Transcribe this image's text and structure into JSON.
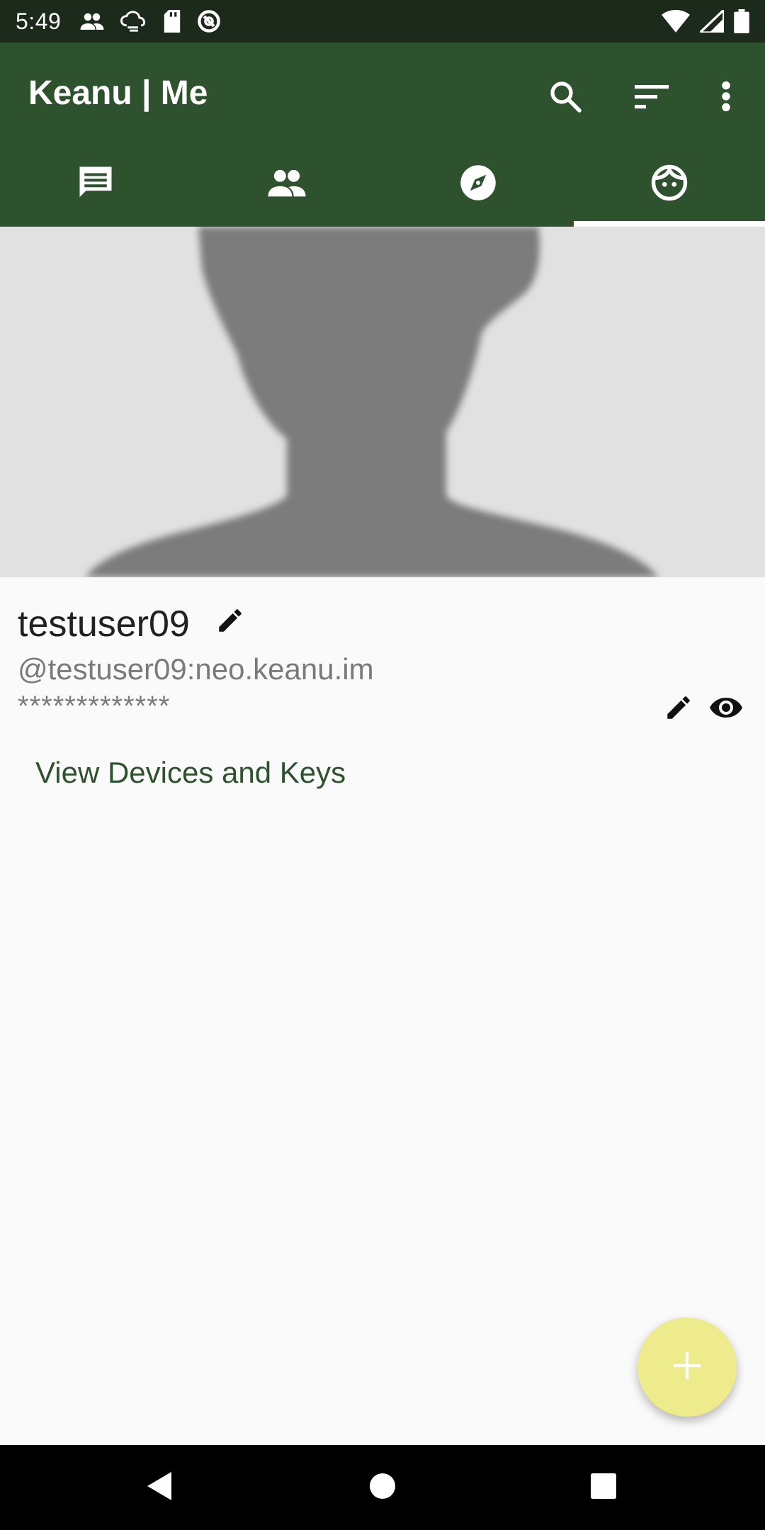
{
  "status_bar": {
    "time": "5:49",
    "left_icons": [
      "people-icon",
      "cloud-sync-icon",
      "sd-card-icon",
      "no-disturb-icon"
    ],
    "right_icons": [
      "wifi-icon",
      "signal-icon",
      "battery-icon"
    ]
  },
  "toolbar": {
    "title": "Keanu | Me",
    "actions": [
      "search-icon",
      "sort-icon",
      "more-vert-icon"
    ]
  },
  "tabs": [
    {
      "icon": "chat-icon",
      "active": false
    },
    {
      "icon": "contacts-icon",
      "active": false
    },
    {
      "icon": "explore-icon",
      "active": false
    },
    {
      "icon": "face-icon",
      "active": true
    }
  ],
  "profile": {
    "display_name": "testuser09",
    "user_id": "@testuser09:neo.keanu.im",
    "password_masked": "*************",
    "devices_link": "View Devices and Keys"
  },
  "fab": {
    "icon": "plus-icon"
  },
  "nav_bar": {
    "buttons": [
      "back-icon",
      "home-icon",
      "recents-icon"
    ]
  },
  "colors": {
    "primary": "#2d522d",
    "status_bar": "#1b2a1b",
    "fab": "#eeeb8c",
    "link": "#2d522d",
    "background": "#fafafa"
  }
}
